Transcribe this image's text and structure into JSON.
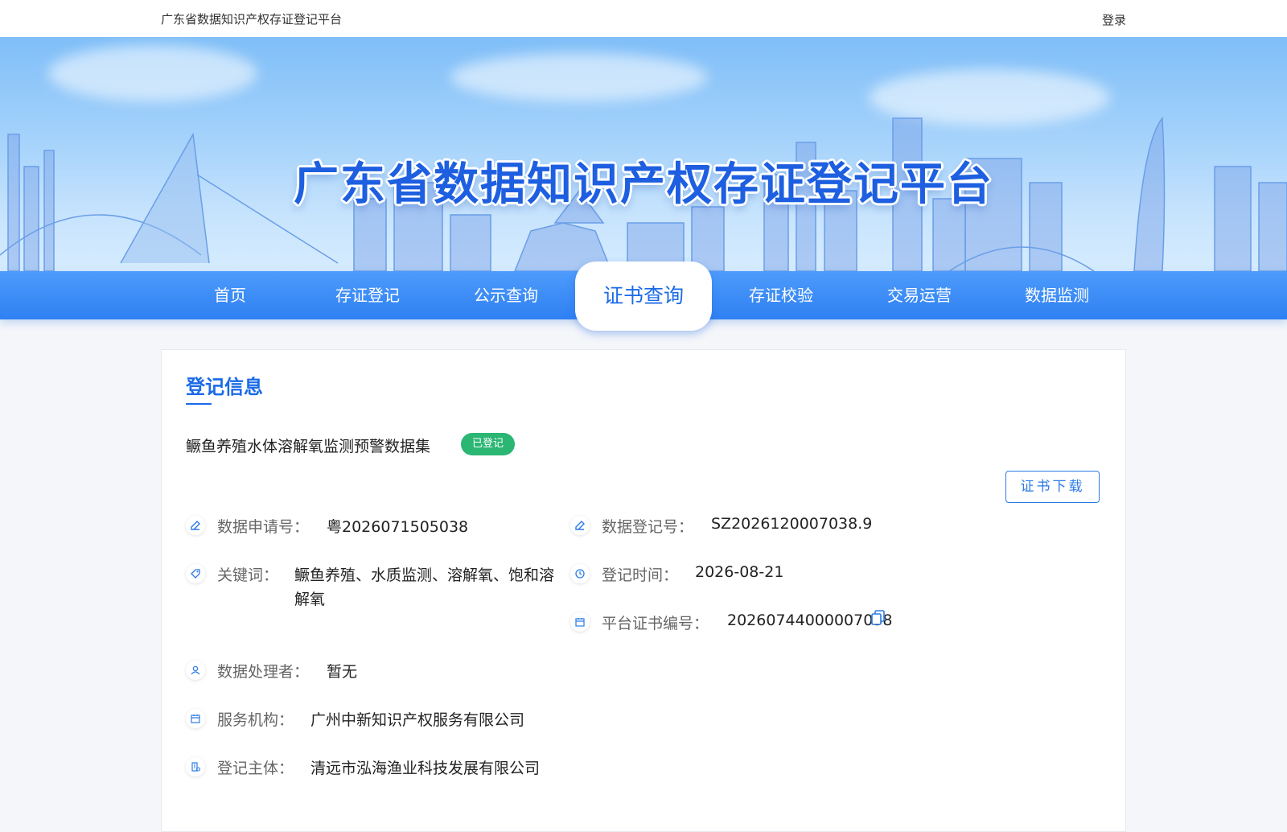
{
  "topbar": {
    "site_title": "广东省数据知识产权存证登记平台",
    "login": "登录"
  },
  "banner": {
    "title": "广东省数据知识产权存证登记平台"
  },
  "nav": {
    "items": [
      "首页",
      "存证登记",
      "公示查询",
      "证书查询",
      "存证校验",
      "交易运营",
      "数据监测"
    ],
    "active": "证书查询"
  },
  "info": {
    "section_title": "登记信息",
    "dataset_name": "鳜鱼养殖水体溶解氧监测预警数据集",
    "status": "已登记",
    "download_button": "证书下载",
    "fields": {
      "application_no": {
        "label": "数据申请号：",
        "value": "粤2026071505038",
        "icon": "edit-icon"
      },
      "registration_no": {
        "label": "数据登记号：",
        "value": "SZ2026120007038.9",
        "icon": "edit-icon"
      },
      "keywords": {
        "label": "关键词：",
        "value_line1": "鳜鱼养殖、水质监测、溶解氧、饱和溶",
        "value_line2": "解氧",
        "icon": "tag-icon"
      },
      "registration_time": {
        "label": "登记时间：",
        "value": "2026-08-21",
        "icon": "clock-icon"
      },
      "certificate_no": {
        "label": "平台证书编号：",
        "value": "20260744000007038",
        "icon": "calendar-icon"
      },
      "data_processor": {
        "label": "数据处理者：",
        "value": "暂无",
        "icon": "user-icon"
      },
      "service_agency": {
        "label": "服务机构：",
        "value": "广州中新知识产权服务有限公司",
        "icon": "calendar-icon"
      },
      "registrant": {
        "label": "登记主体：",
        "value": "清远市泓海渔业科技发展有限公司",
        "icon": "building-icon"
      }
    }
  },
  "colors": {
    "primary": "#1a6ae8",
    "nav": "#2f80f3",
    "badge": "#2bb673"
  }
}
